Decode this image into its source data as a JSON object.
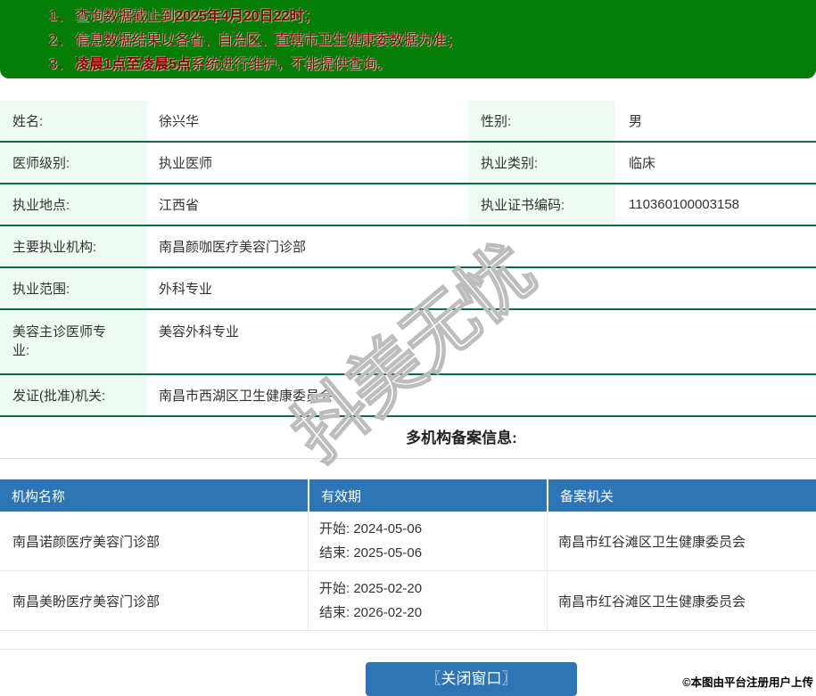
{
  "colors": {
    "banner_green": "#067d06",
    "notice_text_red": "#8f0202",
    "label_mint": "#effaf3",
    "row_border_green": "#0b6c3d",
    "header_blue": "#2e75b5"
  },
  "banner": {
    "items": [
      {
        "num": "1、",
        "pre": "查询数据截止到",
        "bold": "2025年4月20日22时",
        "post": "；"
      },
      {
        "num": "2、",
        "pre": "信息数据结果以各省、自治区、直辖市卫生健康委数据为准；",
        "bold": "",
        "post": ""
      },
      {
        "num": "3、",
        "pre": "",
        "bold": "凌晨1点至凌晨5点",
        "post": "系统进行维护，不能提供查询。"
      }
    ]
  },
  "info_table": {
    "rows": [
      {
        "label1": "姓名:",
        "value1": "徐兴华",
        "label2": "性别:",
        "value2": "男"
      },
      {
        "label1": "医师级别:",
        "value1": "执业医师",
        "label2": "执业类别:",
        "value2": "临床"
      },
      {
        "label1": "执业地点:",
        "value1": "江西省",
        "label2": "执业证书编码:",
        "value2": "110360100003158"
      },
      {
        "label1": "主要执业机构:",
        "value1": "南昌颜咖医疗美容门诊部"
      },
      {
        "label1": "执业范围:",
        "value1": "外科专业"
      },
      {
        "label1": "美容主诊医师专业:",
        "value1": "美容外科专业"
      },
      {
        "label1": "发证(批准)机关:",
        "value1": "南昌市西湖区卫生健康委员会"
      }
    ]
  },
  "section_title": "多机构备案信息:",
  "filing_table": {
    "headers": [
      "机构名称",
      "有效期",
      "备案机关"
    ],
    "rows": [
      {
        "org": "南昌诺颜医疗美容门诊部",
        "start": "开始: 2024-05-06",
        "end": "结束: 2025-05-06",
        "authority": "南昌市红谷滩区卫生健康委员会"
      },
      {
        "org": "南昌美盼医疗美容门诊部",
        "start": "开始: 2025-02-20",
        "end": "结束: 2026-02-20",
        "authority": "南昌市红谷滩区卫生健康委员会"
      }
    ]
  },
  "watermark": "抖美无忧",
  "close_button_label": "〖关闭窗口〗",
  "attribution": "©本图由平台注册用户上传"
}
